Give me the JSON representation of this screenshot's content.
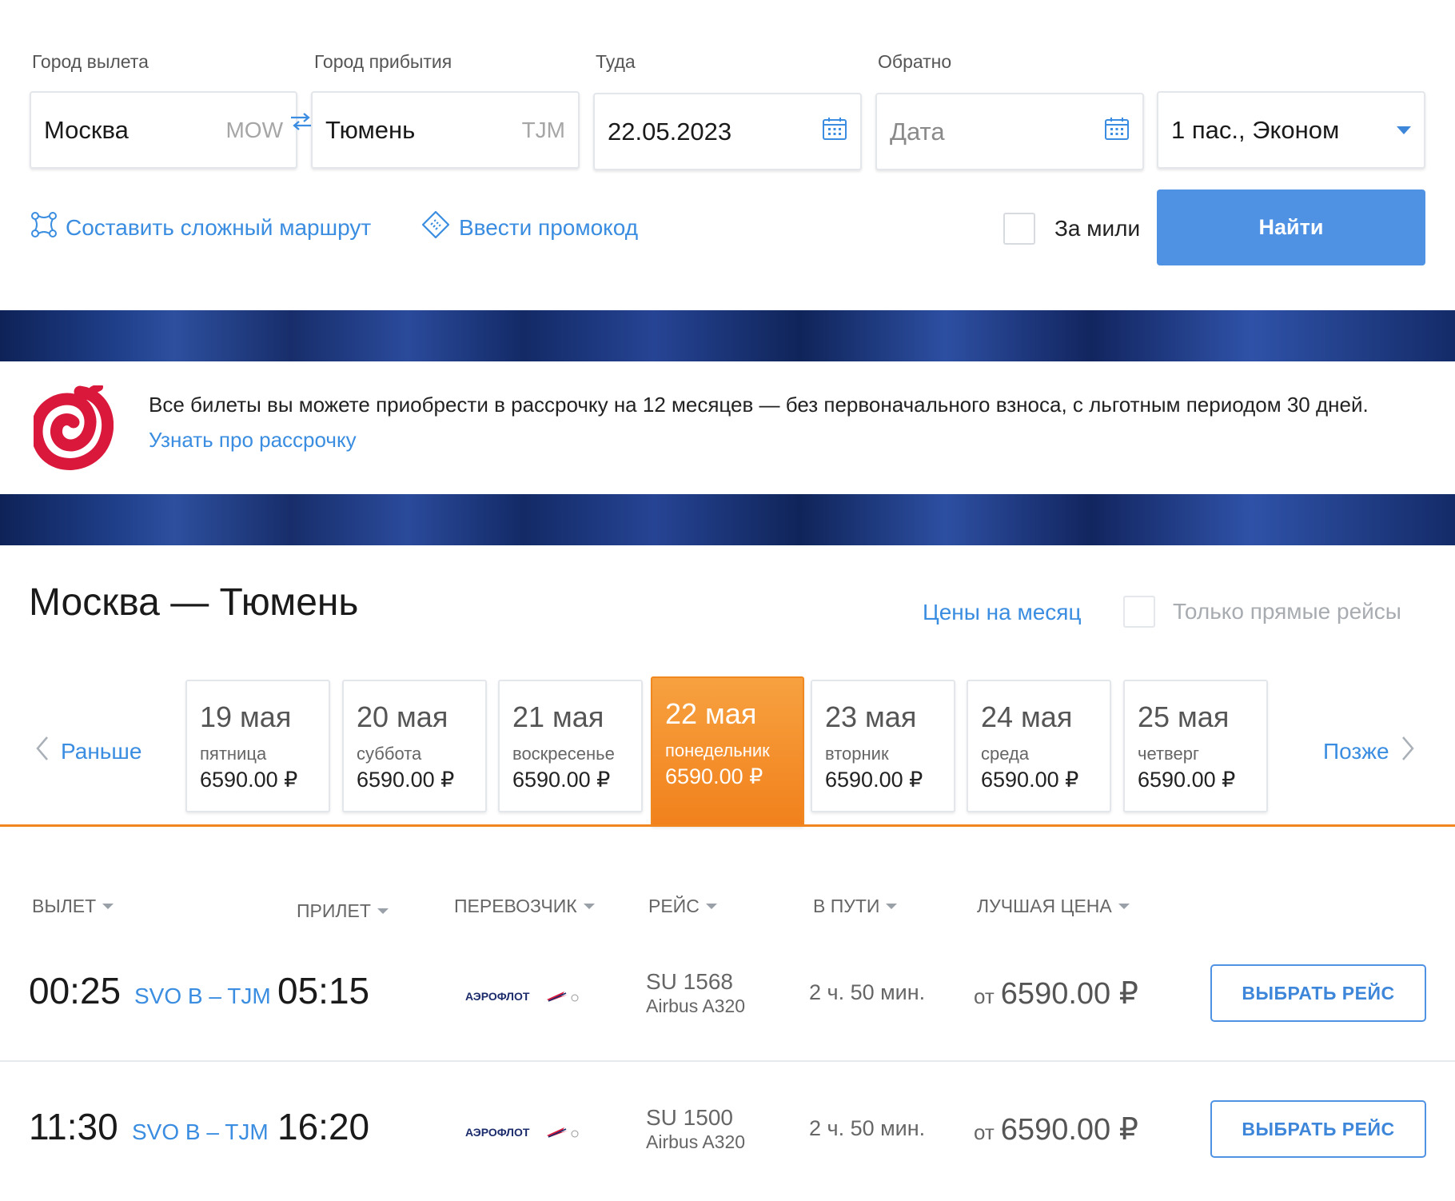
{
  "search": {
    "from_label": "Город вылета",
    "to_label": "Город прибытия",
    "depart_label": "Туда",
    "return_label": "Обратно",
    "from_city": "Москва",
    "from_code": "MOW",
    "to_city": "Тюмень",
    "to_code": "TJM",
    "depart_date": "22.05.2023",
    "return_placeholder": "Дата",
    "passengers": "1 пас., Эконом",
    "complex_route_link": "Составить сложный маршрут",
    "promo_link": "Ввести промокод",
    "miles_label": "За мили",
    "find_button": "Найти"
  },
  "promo": {
    "text": "Все билеты вы можете приобрести в рассрочку на 12 месяцев — без первоначального взноса, с льготным периодом 30 дней.",
    "link": "Узнать про рассрочку"
  },
  "results": {
    "route_title": "Москва — Тюмень",
    "month_prices_link": "Цены на месяц",
    "direct_only_label": "Только прямые рейсы",
    "earlier": "Раньше",
    "later": "Позже",
    "dates": [
      {
        "date": "19 мая",
        "weekday": "пятница",
        "price": "6590.00 ₽"
      },
      {
        "date": "20 мая",
        "weekday": "суббота",
        "price": "6590.00 ₽"
      },
      {
        "date": "21 мая",
        "weekday": "воскресенье",
        "price": "6590.00 ₽"
      },
      {
        "date": "22 мая",
        "weekday": "понедельник",
        "price": "6590.00 ₽"
      },
      {
        "date": "23 мая",
        "weekday": "вторник",
        "price": "6590.00 ₽"
      },
      {
        "date": "24 мая",
        "weekday": "среда",
        "price": "6590.00 ₽"
      },
      {
        "date": "25 мая",
        "weekday": "четверг",
        "price": "6590.00 ₽"
      }
    ],
    "active_date_index": 3,
    "columns": {
      "departure": "ВЫЛЕТ",
      "arrival": "ПРИЛЕТ",
      "carrier": "ПЕРЕВОЗЧИК",
      "flight": "РЕЙС",
      "duration": "В ПУТИ",
      "best_price": "ЛУЧШАЯ ЦЕНА"
    },
    "flights": [
      {
        "dep_time": "00:25",
        "airports": "SVO B – TJM",
        "arr_time": "05:15",
        "carrier": "АЭРОФЛОТ",
        "flight_no": "SU 1568",
        "aircraft": "Airbus A320",
        "duration": "2 ч. 50 мин.",
        "price_prefix": "от",
        "price": "6590.00 ₽",
        "select": "ВЫБРАТЬ РЕЙС"
      },
      {
        "dep_time": "11:30",
        "airports": "SVO B – TJM",
        "arr_time": "16:20",
        "carrier": "АЭРОФЛОТ",
        "flight_no": "SU 1500",
        "aircraft": "Airbus A320",
        "duration": "2 ч. 50 мин.",
        "price_prefix": "от",
        "price": "6590.00 ₽",
        "select": "ВЫБРАТЬ РЕЙС"
      }
    ]
  },
  "colors": {
    "accent_blue": "#3a8de0",
    "button_blue": "#4f92e3",
    "active_orange": "#f1811c",
    "brand_red": "#d9183b"
  },
  "icons": [
    "swap-arrows-icon",
    "calendar-icon",
    "dropdown-caret-icon",
    "route-nodes-icon",
    "promo-ticket-icon",
    "installment-logo-icon",
    "chevron-left-icon",
    "chevron-right-icon",
    "sort-caret-icon",
    "aeroflot-logo-icon"
  ]
}
